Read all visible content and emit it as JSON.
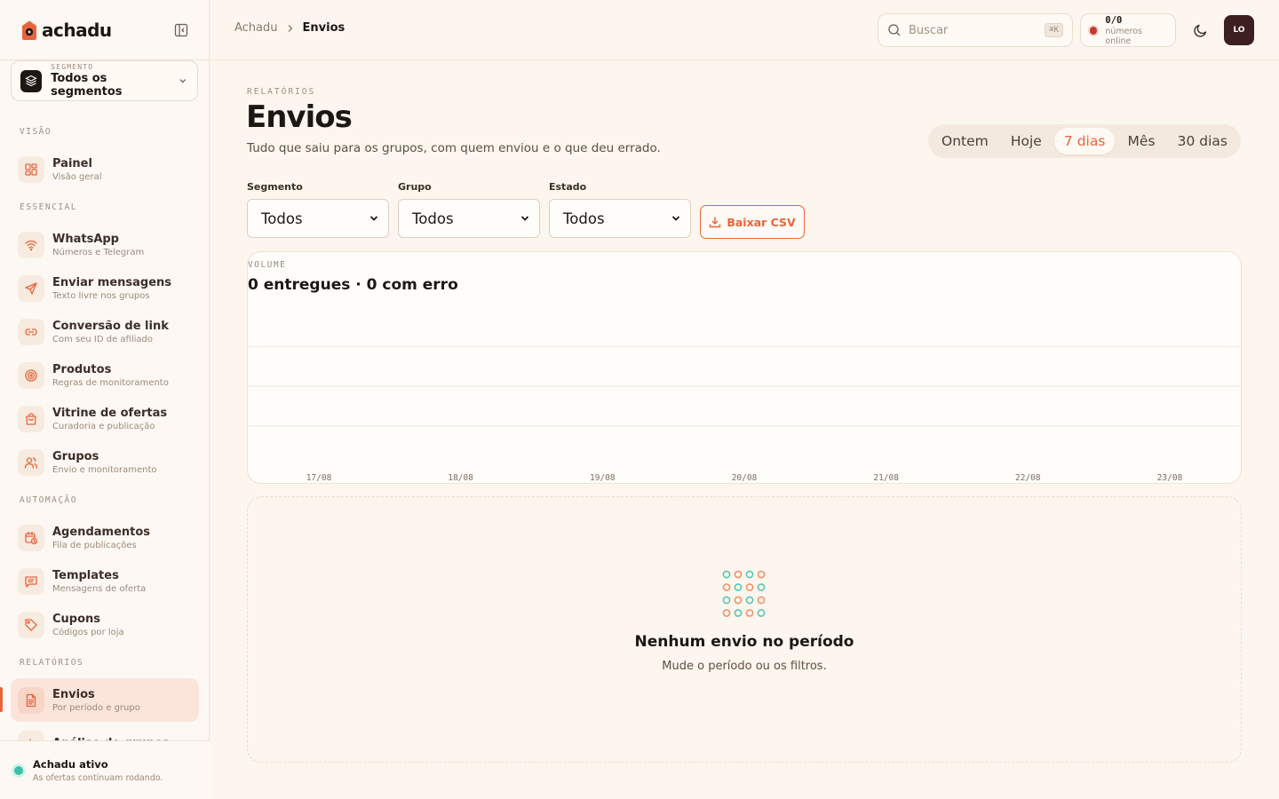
{
  "app": {
    "name": "achadu",
    "accent": "#e8643c"
  },
  "segment": {
    "kicker": "SEGMENTO",
    "value": "Todos os segmentos"
  },
  "nav": {
    "sections": [
      {
        "label": "VISÃO",
        "items": [
          {
            "title": "Painel",
            "sub": "Visão geral",
            "icon": "grid-icon"
          }
        ]
      },
      {
        "label": "ESSENCIAL",
        "items": [
          {
            "title": "WhatsApp",
            "sub": "Números e Telegram",
            "icon": "wifi-icon"
          },
          {
            "title": "Enviar mensagens",
            "sub": "Texto livre nos grupos",
            "icon": "send-icon"
          },
          {
            "title": "Conversão de link",
            "sub": "Com seu ID de afiliado",
            "icon": "link-icon"
          },
          {
            "title": "Produtos",
            "sub": "Regras de monitoramento",
            "icon": "target-icon"
          },
          {
            "title": "Vitrine de ofertas",
            "sub": "Curadoria e publicação",
            "icon": "bag-icon"
          },
          {
            "title": "Grupos",
            "sub": "Envio e monitoramento",
            "icon": "users-icon"
          }
        ]
      },
      {
        "label": "AUTOMAÇÃO",
        "items": [
          {
            "title": "Agendamentos",
            "sub": "Fila de publicações",
            "icon": "calendar-clock-icon"
          },
          {
            "title": "Templates",
            "sub": "Mensagens de oferta",
            "icon": "message-icon"
          },
          {
            "title": "Cupons",
            "sub": "Códigos por loja",
            "icon": "tag-icon"
          }
        ]
      },
      {
        "label": "RELATÓRIOS",
        "items": [
          {
            "title": "Envios",
            "sub": "Por período e grupo",
            "icon": "file-text-icon",
            "active": true
          },
          {
            "title": "Análise de grupos",
            "sub": "",
            "icon": "bar-chart-icon"
          }
        ]
      }
    ]
  },
  "status": {
    "title": "Achadu ativo",
    "sub": "As ofertas continuam rodando."
  },
  "topbar": {
    "breadcrumb_root": "Achadu",
    "breadcrumb_current": "Envios",
    "search_placeholder": "Buscar",
    "search_shortcut": "⌘K",
    "online_count": "0/0",
    "online_label": "números online",
    "avatar_initials": "LO"
  },
  "page": {
    "kicker": "RELATÓRIOS",
    "title": "Envios",
    "subtitle": "Tudo que saiu para os grupos, com quem enviou e o que deu errado."
  },
  "period_tabs": [
    {
      "label": "Ontem",
      "active": false
    },
    {
      "label": "Hoje",
      "active": false
    },
    {
      "label": "7 dias",
      "active": true
    },
    {
      "label": "Mês",
      "active": false
    },
    {
      "label": "30 dias",
      "active": false
    }
  ],
  "filters": [
    {
      "label": "Segmento",
      "value": "Todos"
    },
    {
      "label": "Grupo",
      "value": "Todos"
    },
    {
      "label": "Estado",
      "value": "Todos"
    }
  ],
  "csv_button": "Baixar CSV",
  "chart": {
    "kicker": "VOLUME",
    "title": "0 entregues · 0 com erro"
  },
  "chart_data": {
    "type": "bar",
    "categories": [
      "17/08",
      "18/08",
      "19/08",
      "20/08",
      "21/08",
      "22/08",
      "23/08"
    ],
    "series": [
      {
        "name": "entregues",
        "values": [
          0,
          0,
          0,
          0,
          0,
          0,
          0
        ]
      },
      {
        "name": "com erro",
        "values": [
          0,
          0,
          0,
          0,
          0,
          0,
          0
        ]
      }
    ],
    "grid": true,
    "xlabel": "",
    "ylabel": ""
  },
  "empty": {
    "title": "Nenhum envio no período",
    "sub": "Mude o período ou os filtros."
  }
}
